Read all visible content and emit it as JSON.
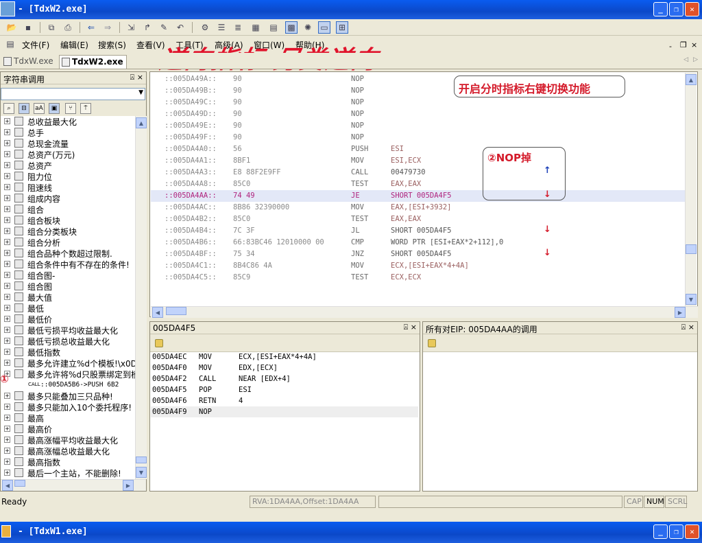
{
  "window": {
    "title": "- [TdxW2.exe]",
    "bottom_title": "- [TdxW1.exe]"
  },
  "menu": [
    "文件(F)",
    "编辑(E)",
    "搜索(S)",
    "查看(V)",
    "工具(T)",
    "高级(A)",
    "窗口(W)",
    "帮助(H)"
  ],
  "mdi_controls": [
    "-",
    "×"
  ],
  "watermark": "逆向指标 另类逆向",
  "tabs": [
    {
      "label": "TdxW.exe"
    },
    {
      "label": "TdxW2.exe"
    }
  ],
  "tab_nav": [
    "◁",
    "▷"
  ],
  "left_panel": {
    "title": "字符串调用",
    "pins": "⍓ ×",
    "items": [
      "总收益最大化",
      "总手",
      "总现金流量",
      "总资产(万元)",
      "总资产",
      "阻力位",
      "阻速线",
      "组成内容",
      "组合",
      "组合板块",
      "组合分类板块",
      "组合分析",
      "组合品种个数超过限制.",
      "组合条件中有不存在的条件!",
      "组合图-",
      "组合图",
      "最大值",
      "最低",
      "最低价",
      "最低亏损平均收益最大化",
      "最低亏损总收益最大化",
      "最低指数",
      "最多允许建立%d个模板!\\x0D\\",
      "最多允许将%d只股票绑定到模",
      "::005DA5B6->PUSH      6B2",
      "最多只能叠加三只品种!",
      "最多只能加入10个委托程序!",
      "最高",
      "最高价",
      "最高涨幅平均收益最大化",
      "最高涨幅总收益最大化",
      "最高指数",
      "最后一个主站，不能删除!"
    ],
    "call_tag": "CALL",
    "marker": "①"
  },
  "disasm": [
    {
      "addr": "::005DA49A::",
      "bytes": "90",
      "mn": "NOP",
      "op": ""
    },
    {
      "addr": "::005DA49B::",
      "bytes": "90",
      "mn": "NOP",
      "op": ""
    },
    {
      "addr": "::005DA49C::",
      "bytes": "90",
      "mn": "NOP",
      "op": ""
    },
    {
      "addr": "::005DA49D::",
      "bytes": "90",
      "mn": "NOP",
      "op": ""
    },
    {
      "addr": "::005DA49E::",
      "bytes": "90",
      "mn": "NOP",
      "op": ""
    },
    {
      "addr": "::005DA49F::",
      "bytes": "90",
      "mn": "NOP",
      "op": ""
    },
    {
      "addr": "::005DA4A0::",
      "bytes": "56",
      "mn": "PUSH",
      "op": "ESI"
    },
    {
      "addr": "::005DA4A1::",
      "bytes": "8BF1",
      "mn": "MOV",
      "op": "ESI,ECX"
    },
    {
      "addr": "::005DA4A3::",
      "bytes": "E8 88F2E9FF",
      "mn": "CALL",
      "op": "00479730"
    },
    {
      "addr": "::005DA4A8::",
      "bytes": "85C0",
      "mn": "TEST",
      "op": "EAX,EAX"
    },
    {
      "addr": "::005DA4AA::",
      "bytes": "74 49",
      "mn": "JE",
      "op": "SHORT 005DA4F5"
    },
    {
      "addr": "::005DA4AC::",
      "bytes": "8B86 32390000",
      "mn": "MOV",
      "op": "EAX,[ESI+3932]"
    },
    {
      "addr": "::005DA4B2::",
      "bytes": "85C0",
      "mn": "TEST",
      "op": "EAX,EAX"
    },
    {
      "addr": "::005DA4B4::",
      "bytes": "7C 3F",
      "mn": "JL",
      "op": "SHORT 005DA4F5"
    },
    {
      "addr": "::005DA4B6::",
      "bytes": "66:83BC46 12010000 00",
      "mn": "CMP",
      "op": "WORD PTR [ESI+EAX*2+112],0"
    },
    {
      "addr": "::005DA4BF::",
      "bytes": "75 34",
      "mn": "JNZ",
      "op": "SHORT 005DA4F5"
    },
    {
      "addr": "::005DA4C1::",
      "bytes": "8B4C86 4A",
      "mn": "MOV",
      "op": "ECX,[ESI+EAX*4+4A]"
    },
    {
      "addr": "::005DA4C5::",
      "bytes": "85C9",
      "mn": "TEST",
      "op": "ECX,ECX"
    }
  ],
  "selected_index": 10,
  "callout1": "开启分时指标右键切换功能",
  "callout2": "②NOP掉",
  "arrows": {
    "up": "↑",
    "down": "↓"
  },
  "sub_panel_left": {
    "title": "005DA4F5",
    "pins": "⍓ ×",
    "rows": [
      {
        "addr": "005DA4EC",
        "mn": "MOV",
        "op": "ECX,[ESI+EAX*4+4A]"
      },
      {
        "addr": "005DA4F0",
        "mn": "MOV",
        "op": "EDX,[ECX]"
      },
      {
        "addr": "005DA4F2",
        "mn": "CALL",
        "op": "NEAR [EDX+4]"
      },
      {
        "addr": "005DA4F5",
        "mn": "POP",
        "op": "ESI"
      },
      {
        "addr": "005DA4F6",
        "mn": "RETN",
        "op": "4"
      },
      {
        "addr": "005DA4F9",
        "mn": "NOP",
        "op": ""
      }
    ]
  },
  "sub_panel_right": {
    "title": "所有对EIP: 005DA4AA的调用",
    "pins": "⍓ ×"
  },
  "status": {
    "ready": "Ready",
    "rva": "RVA:1DA4AA,Offset:1DA4AA",
    "cap": "CAP",
    "num": "NUM",
    "scrl": "SCRL"
  }
}
